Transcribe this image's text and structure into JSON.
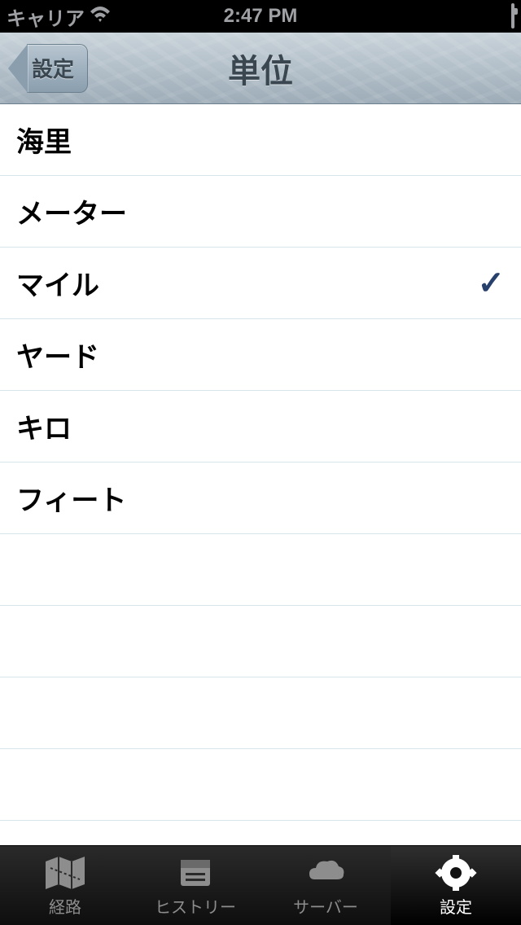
{
  "status": {
    "carrier": "キャリア",
    "time": "2:47 PM"
  },
  "nav": {
    "back_label": "設定",
    "title": "単位"
  },
  "units": [
    {
      "label": "海里",
      "selected": false
    },
    {
      "label": "メーター",
      "selected": false
    },
    {
      "label": "マイル",
      "selected": true
    },
    {
      "label": "ヤード",
      "selected": false
    },
    {
      "label": "キロ",
      "selected": false
    },
    {
      "label": "フィート",
      "selected": false
    }
  ],
  "tabs": [
    {
      "label": "経路",
      "icon": "map-icon",
      "active": false
    },
    {
      "label": "ヒストリー",
      "icon": "history-icon",
      "active": false
    },
    {
      "label": "サーバー",
      "icon": "server-icon",
      "active": false
    },
    {
      "label": "設定",
      "icon": "gear-icon",
      "active": true
    }
  ]
}
